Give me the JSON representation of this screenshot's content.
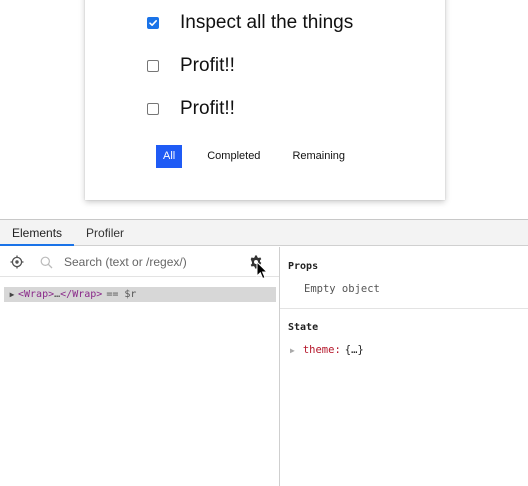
{
  "todos": [
    {
      "text": "Inspect all the things",
      "checked": true
    },
    {
      "text": "Profit!!",
      "checked": false
    },
    {
      "text": "Profit!!",
      "checked": false
    }
  ],
  "filters": {
    "all": "All",
    "completed": "Completed",
    "remaining": "Remaining",
    "active": "All"
  },
  "devtools": {
    "tabs": [
      "Elements",
      "Profiler"
    ],
    "active_tab": "Elements",
    "search": {
      "placeholder": "Search (text or /regex/)",
      "value": ""
    },
    "tree": {
      "arrow": "▶",
      "open_tag": "<Wrap>",
      "ellipsis": "…",
      "close_tag": "</Wrap>",
      "ref": "== $r"
    },
    "props": {
      "title": "Props",
      "empty": "Empty object"
    },
    "state": {
      "title": "State",
      "key": "theme",
      "colon": ":",
      "value": "{…}"
    }
  },
  "colors": {
    "accent": "#1f5bf5",
    "checkbox": "#1a73e8",
    "tag": "#8a2a8a",
    "state_key": "#b5172b"
  },
  "icons": {
    "target": "crosshair-target-icon",
    "search": "search-icon",
    "settings": "gear-icon",
    "cursor": "mouse-cursor-icon"
  }
}
